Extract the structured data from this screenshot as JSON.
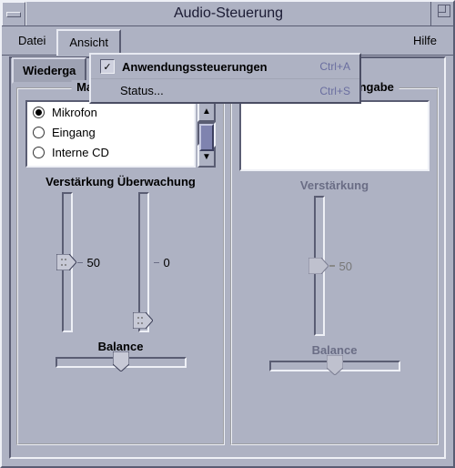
{
  "window": {
    "title": "Audio-Steuerung"
  },
  "menubar": {
    "file": "Datei",
    "view": "Ansicht",
    "help": "Hilfe"
  },
  "dropdown": {
    "item1": {
      "label": "Anwendungssteuerungen",
      "accel": "Ctrl+A",
      "checked": true
    },
    "item2": {
      "label": "Status...",
      "accel": "Ctrl+S"
    }
  },
  "tab": {
    "label": "Wiederga"
  },
  "left": {
    "title": "Master-Eingabe",
    "options": {
      "o1": "Mikrofon",
      "o2": "Eingang",
      "o3": "Interne CD"
    },
    "label_gain": "Verstärkung",
    "label_monitor": "Überwachung",
    "gain_value": "50",
    "monitor_value": "0",
    "balance_label": "Balance"
  },
  "right": {
    "title": "Anwendungseingabe",
    "label_gain": "Verstärkung",
    "gain_value": "50",
    "balance_label": "Balance"
  },
  "icons": {
    "up": "▲",
    "down": "▼",
    "check": "✓"
  }
}
